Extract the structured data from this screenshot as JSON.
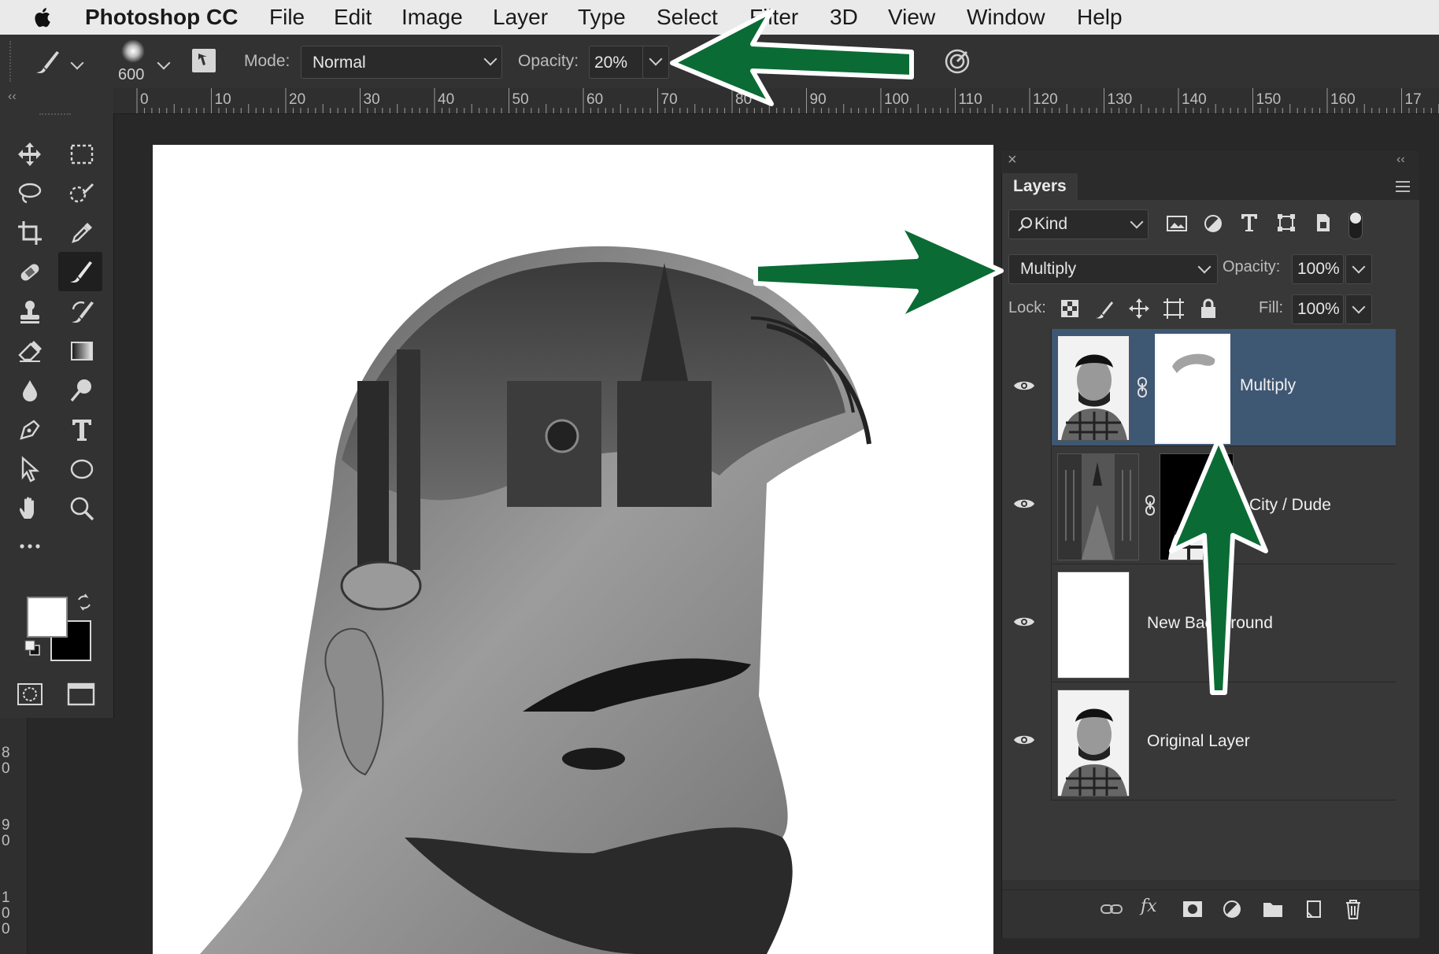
{
  "menubar": {
    "app_name": "Photoshop CC",
    "items": [
      "File",
      "Edit",
      "Image",
      "Layer",
      "Type",
      "Select",
      "Filter",
      "3D",
      "View",
      "Window",
      "Help"
    ]
  },
  "options_bar": {
    "brush_size": "600",
    "mode_label": "Mode:",
    "mode_value": "Normal",
    "opacity_label": "Opacity:",
    "opacity_value": "20%"
  },
  "ruler": {
    "ticks": [
      "0",
      "10",
      "20",
      "30",
      "40",
      "50",
      "60",
      "70",
      "80",
      "90",
      "100",
      "110",
      "120",
      "130",
      "140",
      "150",
      "160",
      "17"
    ],
    "vertical_digits": [
      "8",
      "0",
      "9",
      "0",
      "1",
      "0",
      "0"
    ]
  },
  "toolbar": {
    "tools": [
      "move-tool",
      "marquee-tool",
      "lasso-tool",
      "quick-select-tool",
      "crop-tool",
      "eyedropper-tool",
      "healing-brush-tool",
      "brush-tool",
      "clone-stamp-tool",
      "history-brush-tool",
      "eraser-tool",
      "gradient-tool",
      "blur-tool",
      "dodge-tool",
      "pen-tool",
      "type-tool",
      "path-select-tool",
      "ellipse-tool",
      "hand-tool",
      "zoom-tool"
    ],
    "selected_tool": "brush-tool",
    "foreground_color": "#ffffff",
    "background_color": "#000000"
  },
  "layers_panel": {
    "title": "Layers",
    "filter_kind": "Kind",
    "blend_mode": "Multiply",
    "opacity_label": "Opacity:",
    "opacity_value": "100%",
    "lock_label": "Lock:",
    "fill_label": "Fill:",
    "fill_value": "100%",
    "layers": [
      {
        "name": "Multiply",
        "selected": true,
        "has_mask": true
      },
      {
        "name": "City / Dude",
        "selected": false,
        "has_mask": true
      },
      {
        "name": "New Background",
        "selected": false,
        "has_mask": false
      },
      {
        "name": "Original Layer",
        "selected": false,
        "has_mask": false
      }
    ]
  },
  "annotations": {
    "arrow_color": "#0b6b34"
  }
}
